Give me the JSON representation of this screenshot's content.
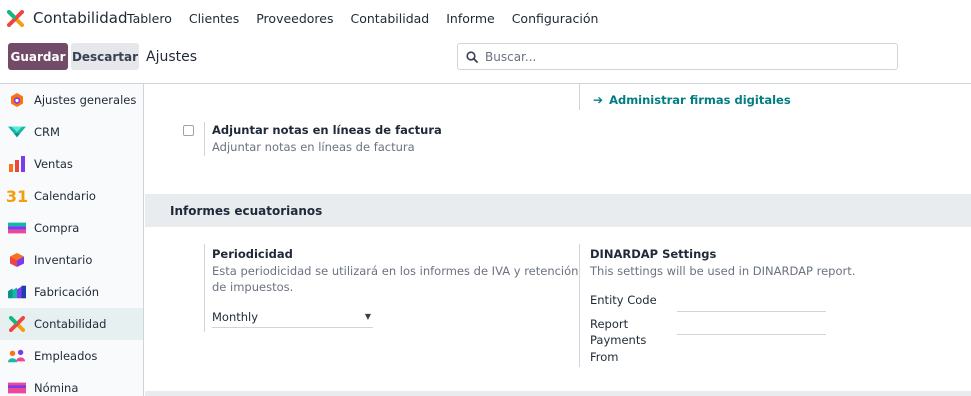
{
  "navbar": {
    "app_name": "Contabilidad",
    "menu": [
      "Tablero",
      "Clientes",
      "Proveedores",
      "Contabilidad",
      "Informe",
      "Configuración"
    ]
  },
  "controls": {
    "save_label": "Guardar",
    "discard_label": "Descartar",
    "breadcrumb": "Ajustes",
    "search_placeholder": "Buscar..."
  },
  "sidebar": {
    "items": [
      {
        "label": "Ajustes generales",
        "icon": "settings-hexagon-icon"
      },
      {
        "label": "CRM",
        "icon": "crm-icon"
      },
      {
        "label": "Ventas",
        "icon": "sales-chart-icon"
      },
      {
        "label": "Calendario",
        "icon": "calendar-icon"
      },
      {
        "label": "Compra",
        "icon": "purchase-icon"
      },
      {
        "label": "Inventario",
        "icon": "inventory-box-icon"
      },
      {
        "label": "Fabricación",
        "icon": "manufacturing-icon"
      },
      {
        "label": "Contabilidad",
        "icon": "accounting-icon",
        "active": true
      },
      {
        "label": "Empleados",
        "icon": "employees-icon"
      },
      {
        "label": "Nómina",
        "icon": "payroll-icon"
      }
    ],
    "calendar_number": "31"
  },
  "main": {
    "digital_signatures_link": "Administrar firmas digitales",
    "invoice_notes": {
      "title": "Adjuntar notas en líneas de factura",
      "description": "Adjuntar notas en líneas de factura",
      "checked": false
    },
    "section_title": "Informes ecuatorianos",
    "periodicity": {
      "title": "Periodicidad",
      "description_line1": "Esta periodicidad se utilizará en los informes de IVA y retención",
      "description_line2": "de impuestos.",
      "selected": "Monthly"
    },
    "dinardap": {
      "title": "DINARDAP Settings",
      "description": "This settings will be used in DINARDAP report.",
      "entity_code_label": "Entity Code",
      "report_payments_from_line1": "Report",
      "report_payments_from_line2": "Payments",
      "report_payments_from_line3": "From"
    }
  },
  "colors": {
    "primary": "#714b67",
    "link": "#017e84",
    "active_bg": "#e6f0f1"
  }
}
